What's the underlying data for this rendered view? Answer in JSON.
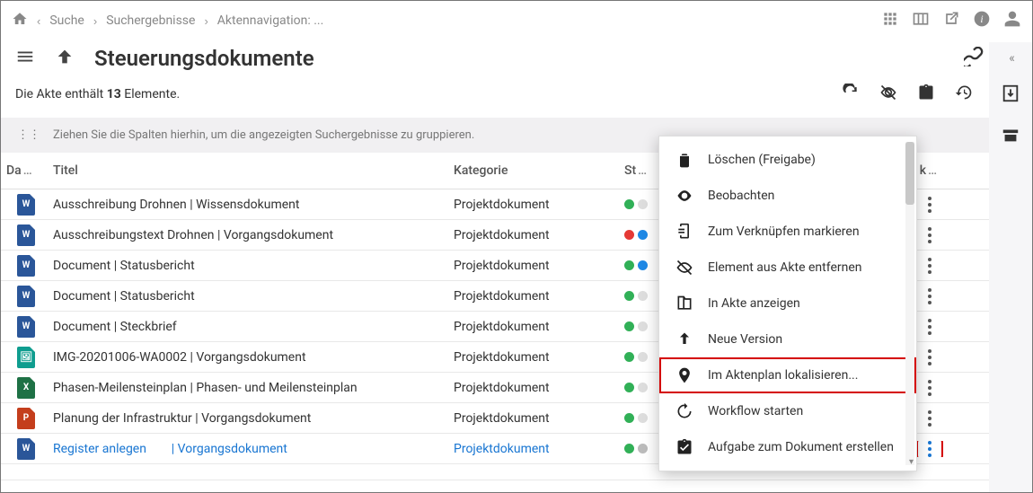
{
  "breadcrumb": {
    "b1": "Suche",
    "b2": "Suchergebnisse",
    "b3": "Aktennavigation: ..."
  },
  "title": "Steuerungsdokumente",
  "count_prefix": "Die Akte enthält ",
  "count_n": "13",
  "count_suffix": " Elemente.",
  "group_hint": "Ziehen Sie die Spalten hierhin, um die angezeigten Suchergebnisse zu gruppieren.",
  "cols": {
    "da": "Da",
    "titel": "Titel",
    "kat": "Kategorie",
    "st": "St",
    "k": "k"
  },
  "kategorie_value": "Projektdokument",
  "rows": [
    {
      "title": "Ausschreibung Drohnen | Wissensdokument",
      "icon": "w-blue"
    },
    {
      "title": "Ausschreibungstext Drohnen | Vorgangsdokument",
      "icon": "w-blue"
    },
    {
      "title": "Document | Statusbericht",
      "icon": "w-blue"
    },
    {
      "title": "Document | Statusbericht",
      "icon": "w-blue"
    },
    {
      "title": "Document | Steckbrief",
      "icon": "w-blue"
    },
    {
      "title": "IMG-20201006-WA0002 | Vorgangsdokument",
      "icon": "img-teal"
    },
    {
      "title": "Phasen-Meilensteinplan | Phasen- und Meilensteinplan",
      "icon": "x-green"
    },
    {
      "title": "Planung der Infrastruktur | Vorgangsdokument",
      "icon": "p-red"
    }
  ],
  "selected_row": {
    "title_a": "Register anlegen",
    "title_b": "| Vorgangsdokument",
    "icon": "w-blue"
  },
  "menu": {
    "m1": "Löschen (Freigabe)",
    "m2": "Beobachten",
    "m3": "Zum Verknüpfen markieren",
    "m4": "Element aus Akte entfernen",
    "m5": "In Akte anzeigen",
    "m6": "Neue Version",
    "m7": "Im Aktenplan lokalisieren...",
    "m8": "Workflow starten",
    "m9": "Aufgabe zum Dokument erstellen"
  }
}
